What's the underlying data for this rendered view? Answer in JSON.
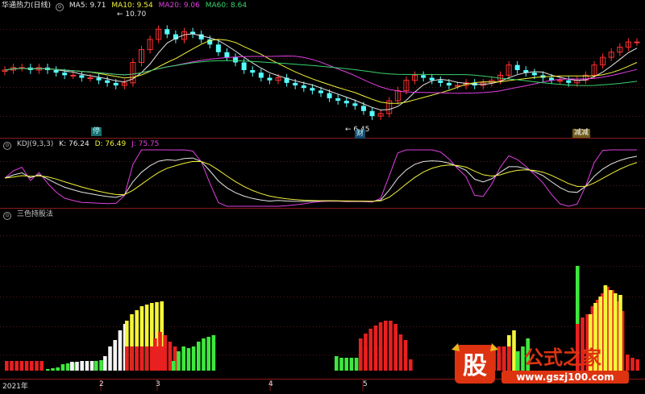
{
  "price_header": {
    "name": "华通热力(日线)",
    "ma5": "MA5: 9.71",
    "ma10": "MA10: 9.54",
    "ma20": "MA20: 9.06",
    "ma60": "MA60: 8.64"
  },
  "kdj_header": {
    "name": "KDJ(9,3,3)",
    "k": "K: 76.24",
    "d": "D: 76.49",
    "j": "J: 75.75"
  },
  "bars_header": {
    "name": "三色持股法"
  },
  "annotations": {
    "high": "10.70",
    "low": "6.45"
  },
  "tags": {
    "t1": "停",
    "t2": "财",
    "t3": "减减"
  },
  "x_labels": [
    "2021年",
    "2",
    "3",
    "4",
    "5"
  ],
  "watermark": {
    "brand": "股",
    "title": "公式之家",
    "url": "www.gszj100.com"
  },
  "colors": {
    "up": "#ff3232",
    "down": "#54ffff",
    "ma5": "#e6e6e6",
    "ma10": "#f2f23a",
    "ma20": "#e040e0",
    "ma60": "#39d36c",
    "bar_red": "#e82020",
    "bar_yellow": "#f5f53a",
    "bar_green": "#3ee83e",
    "bar_white": "#f4f4f4"
  },
  "chart_data": [
    {
      "type": "candlestick",
      "title": "华通热力(日线)",
      "legend": [
        "MA5",
        "MA10",
        "MA20",
        "MA60"
      ],
      "high_marker": 10.7,
      "low_marker": 6.45,
      "close_approx": [
        8.6,
        8.7,
        8.7,
        8.6,
        8.7,
        8.6,
        8.5,
        8.4,
        8.4,
        8.3,
        8.3,
        8.2,
        8.1,
        8.0,
        8.1,
        8.9,
        9.4,
        9.8,
        10.2,
        10.0,
        9.8,
        10.1,
        10.0,
        9.8,
        9.6,
        9.3,
        9.1,
        8.9,
        8.6,
        8.5,
        8.3,
        8.2,
        8.3,
        8.1,
        8.0,
        7.9,
        7.8,
        7.7,
        7.5,
        7.4,
        7.3,
        7.2,
        7.0,
        6.8,
        6.9,
        7.4,
        7.8,
        8.2,
        8.4,
        8.3,
        8.2,
        8.1,
        8.0,
        8.0,
        8.1,
        8.0,
        8.1,
        8.2,
        8.4,
        8.8,
        8.6,
        8.5,
        8.4,
        8.3,
        8.2,
        8.2,
        8.1,
        8.2,
        8.4,
        8.8,
        9.1,
        9.3,
        9.5,
        9.7,
        9.7
      ]
    },
    {
      "type": "line",
      "title": "KDJ(9,3,3)",
      "series": [
        {
          "name": "K",
          "last": 76.24
        },
        {
          "name": "D",
          "last": 76.49
        },
        {
          "name": "J",
          "last": 75.75
        }
      ]
    },
    {
      "type": "bar",
      "title": "三色持股法",
      "series": [
        {
          "name": "red",
          "values": [
            3,
            3,
            3,
            3,
            3,
            3,
            3,
            3,
            0,
            0,
            0,
            0,
            0,
            0,
            0,
            0,
            0,
            0,
            0,
            0,
            0,
            0,
            0,
            0,
            0,
            0,
            1,
            0,
            0,
            0,
            0,
            0,
            0,
            0,
            0,
            0,
            0,
            0,
            0,
            0,
            0,
            0,
            0,
            0,
            12,
            13,
            10,
            8,
            6,
            5,
            4,
            0,
            0,
            0,
            0,
            0,
            0,
            0,
            0,
            0,
            0,
            0,
            0,
            0,
            0,
            0,
            0,
            0,
            0,
            0,
            0,
            0,
            0,
            0,
            0,
            0,
            0,
            0,
            0,
            0,
            0,
            0,
            0,
            0,
            0,
            0,
            0,
            0,
            0,
            0,
            0,
            0,
            0,
            0,
            0,
            0,
            0,
            0,
            0,
            0,
            0,
            0,
            0,
            0,
            0,
            0,
            0,
            0,
            0,
            0,
            0,
            0,
            0,
            0,
            0,
            0,
            0,
            0,
            0,
            0,
            0,
            0,
            0,
            0,
            0,
            0,
            0,
            0,
            0,
            0,
            0,
            0,
            0,
            0,
            0,
            0
          ]
        }
      ],
      "note_values": "heights in chart units 0-28"
    }
  ]
}
